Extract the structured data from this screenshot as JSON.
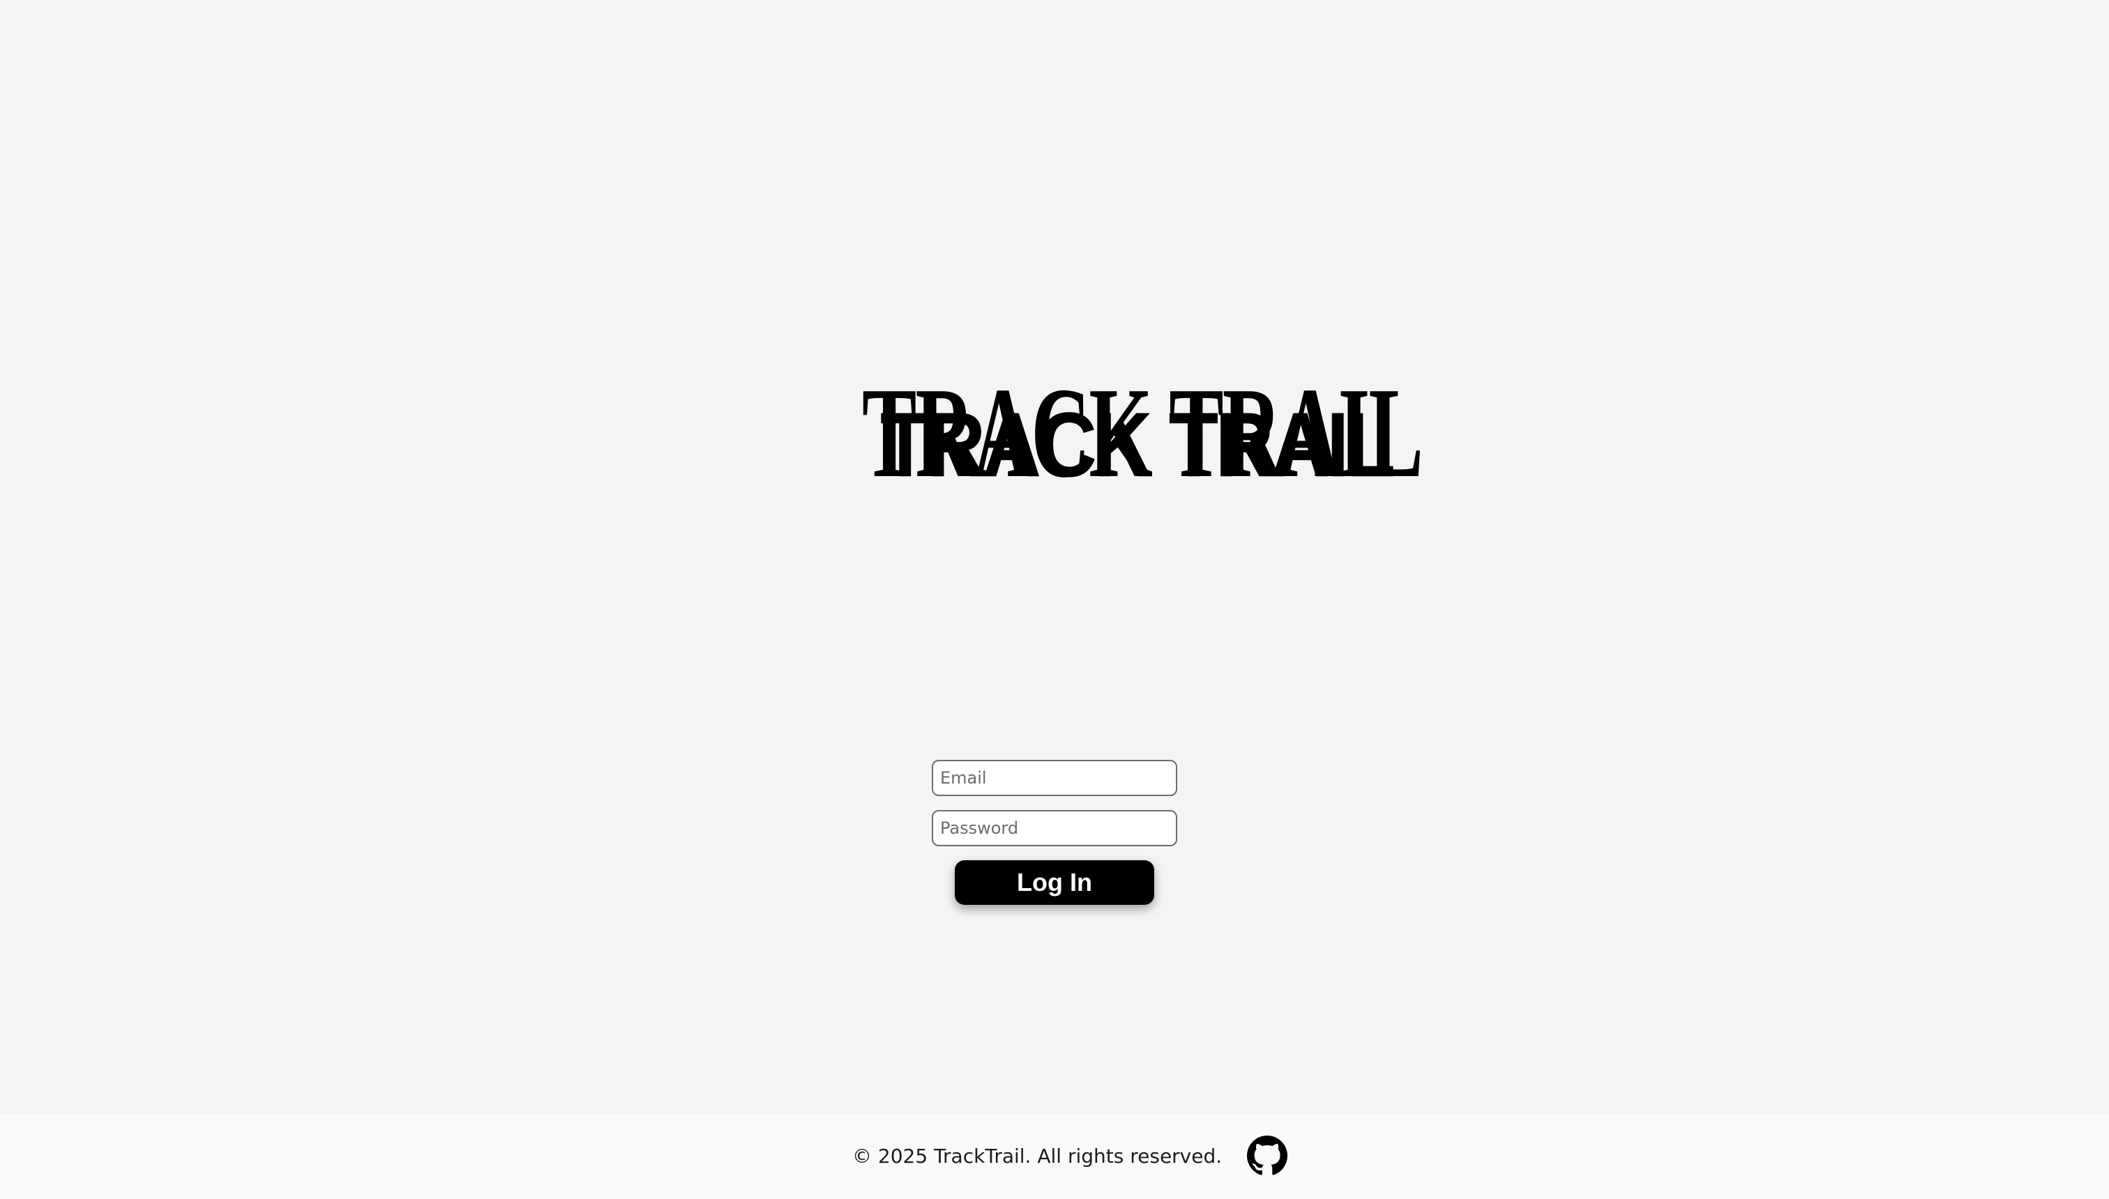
{
  "brand": {
    "logo_text": "TRACK TRAIL"
  },
  "login": {
    "email_placeholder": "Email",
    "password_placeholder": "Password",
    "submit_label": "Log In"
  },
  "footer": {
    "copyright": "© 2025 TrackTrail. All rights reserved.",
    "github_icon": "github-icon"
  },
  "colors": {
    "background": "#f4f4f4",
    "footer_background": "#f8f9fa",
    "button_background": "#000000",
    "button_text": "#ffffff",
    "input_border": "#6e6e6e"
  }
}
